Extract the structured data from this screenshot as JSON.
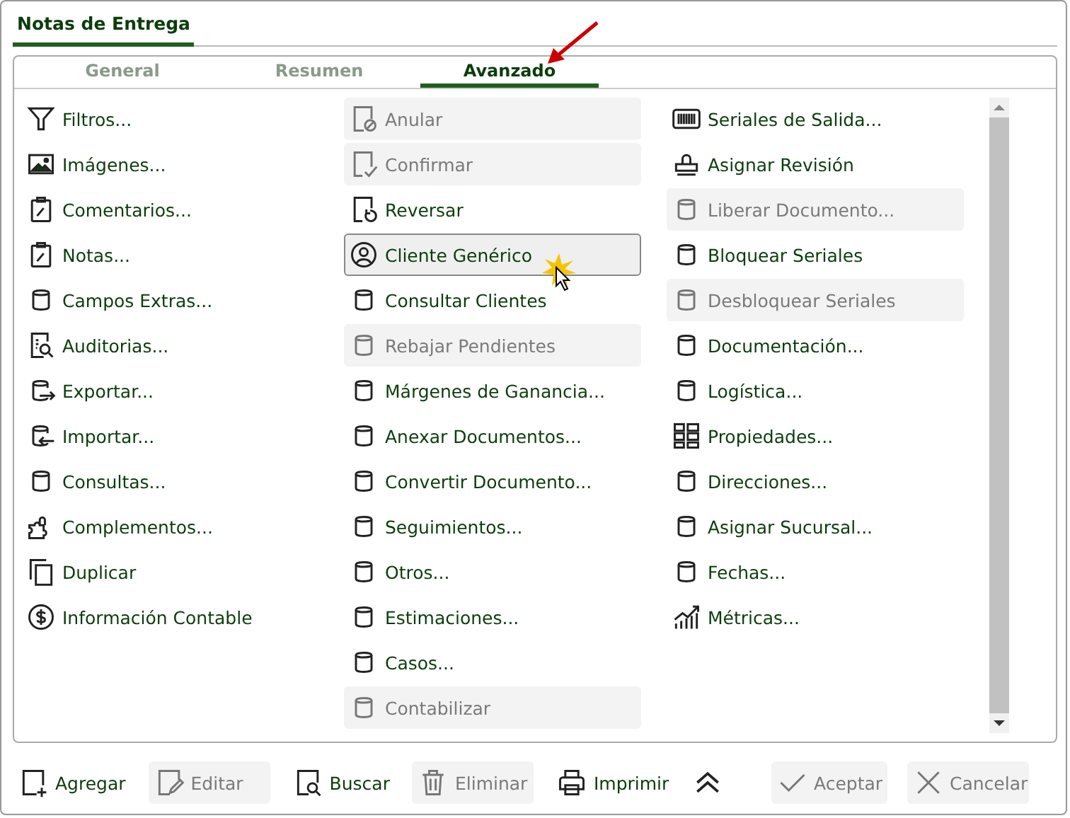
{
  "window": {
    "title": "Notas de Entrega"
  },
  "tabs": [
    {
      "label": "General",
      "selected": false
    },
    {
      "label": "Resumen",
      "selected": false
    },
    {
      "label": "Avanzado",
      "selected": true
    }
  ],
  "columns": [
    [
      {
        "label": "Filtros...",
        "kind": "filter",
        "disabled": false,
        "selected": false
      },
      {
        "label": "Imágenes...",
        "kind": "image",
        "disabled": false,
        "selected": false
      },
      {
        "label": "Comentarios...",
        "kind": "clipboard",
        "disabled": false,
        "selected": false
      },
      {
        "label": "Notas...",
        "kind": "clipboard",
        "disabled": false,
        "selected": false
      },
      {
        "label": "Campos Extras...",
        "kind": "database",
        "disabled": false,
        "selected": false
      },
      {
        "label": "Auditorias...",
        "kind": "audit",
        "disabled": false,
        "selected": false
      },
      {
        "label": "Exportar...",
        "kind": "export",
        "disabled": false,
        "selected": false
      },
      {
        "label": "Importar...",
        "kind": "import",
        "disabled": false,
        "selected": false
      },
      {
        "label": "Consultas...",
        "kind": "database",
        "disabled": false,
        "selected": false
      },
      {
        "label": "Complementos...",
        "kind": "puzzle",
        "disabled": false,
        "selected": false
      },
      {
        "label": "Duplicar",
        "kind": "copy",
        "disabled": false,
        "selected": false
      },
      {
        "label": "Información Contable",
        "kind": "dollar",
        "disabled": false,
        "selected": false
      }
    ],
    [
      {
        "label": "Anular",
        "kind": "cancel",
        "disabled": true,
        "selected": false
      },
      {
        "label": "Confirmar",
        "kind": "confirm",
        "disabled": true,
        "selected": false
      },
      {
        "label": "Reversar",
        "kind": "undo",
        "disabled": false,
        "selected": false
      },
      {
        "label": "Cliente Genérico",
        "kind": "user",
        "disabled": false,
        "selected": true
      },
      {
        "label": "Consultar Clientes",
        "kind": "database",
        "disabled": false,
        "selected": false
      },
      {
        "label": "Rebajar Pendientes",
        "kind": "database",
        "disabled": true,
        "selected": false
      },
      {
        "label": "Márgenes de Ganancia...",
        "kind": "database",
        "disabled": false,
        "selected": false
      },
      {
        "label": "Anexar Documentos...",
        "kind": "database",
        "disabled": false,
        "selected": false
      },
      {
        "label": "Convertir Documento...",
        "kind": "database",
        "disabled": false,
        "selected": false
      },
      {
        "label": "Seguimientos...",
        "kind": "database",
        "disabled": false,
        "selected": false
      },
      {
        "label": "Otros...",
        "kind": "database",
        "disabled": false,
        "selected": false
      },
      {
        "label": "Estimaciones...",
        "kind": "database",
        "disabled": false,
        "selected": false
      },
      {
        "label": "Casos...",
        "kind": "database",
        "disabled": false,
        "selected": false
      },
      {
        "label": "Contabilizar",
        "kind": "database",
        "disabled": true,
        "selected": false
      }
    ],
    [
      {
        "label": "Seriales de Salida...",
        "kind": "barcode",
        "disabled": false,
        "selected": false
      },
      {
        "label": "Asignar Revisión",
        "kind": "stamp",
        "disabled": false,
        "selected": false
      },
      {
        "label": "Liberar Documento...",
        "kind": "database",
        "disabled": true,
        "selected": false
      },
      {
        "label": "Bloquear Seriales",
        "kind": "database",
        "disabled": false,
        "selected": false
      },
      {
        "label": "Desbloquear Seriales",
        "kind": "database",
        "disabled": true,
        "selected": false
      },
      {
        "label": "Documentación...",
        "kind": "database",
        "disabled": false,
        "selected": false
      },
      {
        "label": "Logística...",
        "kind": "database",
        "disabled": false,
        "selected": false
      },
      {
        "label": "Propiedades...",
        "kind": "grid",
        "disabled": false,
        "selected": false
      },
      {
        "label": "Direcciones...",
        "kind": "database",
        "disabled": false,
        "selected": false
      },
      {
        "label": "Asignar Sucursal...",
        "kind": "database",
        "disabled": false,
        "selected": false
      },
      {
        "label": "Fechas...",
        "kind": "database",
        "disabled": false,
        "selected": false
      },
      {
        "label": "Métricas...",
        "kind": "chart",
        "disabled": false,
        "selected": false
      }
    ]
  ],
  "footer_left": [
    {
      "label": "Agregar",
      "kind": "add",
      "disabled": false
    },
    {
      "label": "Editar",
      "kind": "edit",
      "disabled": true
    },
    {
      "label": "Buscar",
      "kind": "search",
      "disabled": false
    },
    {
      "label": "Eliminar",
      "kind": "trash",
      "disabled": true
    },
    {
      "label": "Imprimir",
      "kind": "printer",
      "disabled": false
    }
  ],
  "footer_right": [
    {
      "label": "Aceptar",
      "kind": "check",
      "disabled": true
    },
    {
      "label": "Cancelar",
      "kind": "close",
      "disabled": true
    }
  ]
}
